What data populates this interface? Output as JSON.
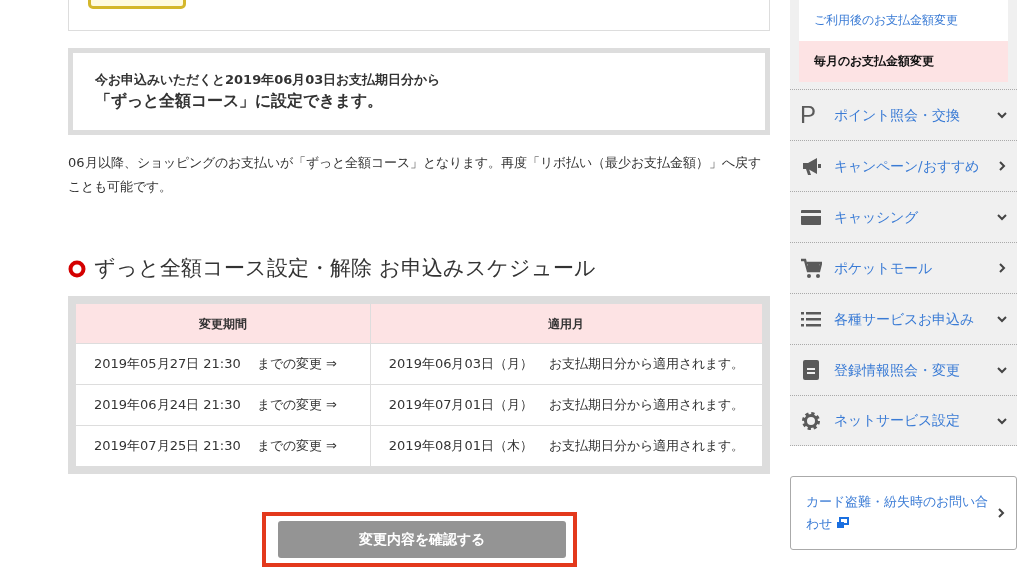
{
  "notice": {
    "line1": "今お申込みいただくと2019年06月03日お支払期日分から",
    "line2": "「ずっと全額コース」に設定できます。"
  },
  "description": "06月以降、ショッピングのお支払いが「ずっと全額コース」となります。再度「リボ払い（最少お支払金額）」へ戻すことも可能です。",
  "schedule": {
    "title": "ずっと全額コース設定・解除 お申込みスケジュール",
    "columns": [
      "変更期間",
      "適用月"
    ],
    "rows": [
      {
        "deadline": "2019年05月27日 21:30",
        "deadline_note": "までの変更 ⇒",
        "month": "2019年06月03日（月）",
        "month_note": "お支払期日分から適用されます。"
      },
      {
        "deadline": "2019年06月24日 21:30",
        "deadline_note": "までの変更 ⇒",
        "month": "2019年07月01日（月）",
        "month_note": "お支払期日分から適用されます。"
      },
      {
        "deadline": "2019年07月25日 21:30",
        "deadline_note": "までの変更 ⇒",
        "month": "2019年08月01日（木）",
        "month_note": "お支払期日分から適用されます。"
      }
    ]
  },
  "confirm_button": {
    "label": "変更内容を確認する",
    "disabled": true,
    "highlighted": true
  },
  "sidebar": {
    "sub_items": [
      {
        "label": "ご利用後のお支払金額変更",
        "selected": false
      },
      {
        "label": "毎月のお支払金額変更",
        "selected": true
      }
    ],
    "menu": [
      {
        "label": "ポイント照会・交換",
        "kind": "accordion",
        "icon_glyph": "P"
      },
      {
        "label": "キャンペーン/おすすめ",
        "kind": "link"
      },
      {
        "label": "キャッシング",
        "kind": "accordion"
      },
      {
        "label": "ポケットモール",
        "kind": "link"
      },
      {
        "label": "各種サービスお申込み",
        "kind": "accordion"
      },
      {
        "label": "登録情報照会・変更",
        "kind": "accordion"
      },
      {
        "label": "ネットサービス設定",
        "kind": "accordion"
      }
    ],
    "contact": {
      "label": "カード盗難・紛失時のお問い合わせ"
    }
  }
}
